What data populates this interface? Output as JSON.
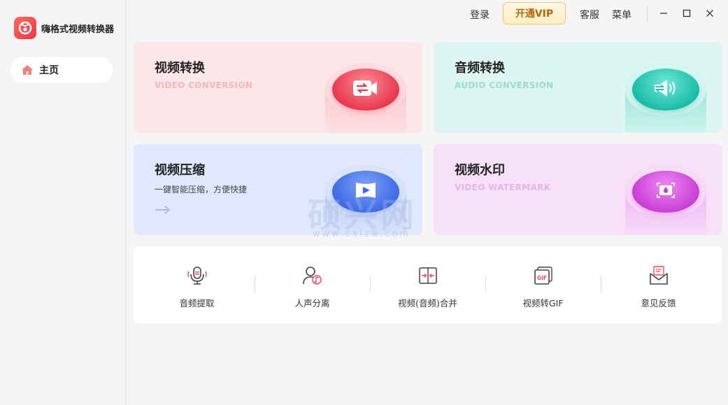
{
  "app": {
    "name": "嗨格式视频转换器"
  },
  "sidebar": {
    "home_label": "主页"
  },
  "topbar": {
    "login": "登录",
    "vip": "开通VIP",
    "service": "客服",
    "menu": "菜单"
  },
  "cards": {
    "video_convert": {
      "title": "视频转换",
      "subtitle": "VIDEO CONVERSION"
    },
    "audio_convert": {
      "title": "音频转换",
      "subtitle": "AUDIO CONVERSION"
    },
    "video_compress": {
      "title": "视频压缩",
      "desc": "一键智能压缩，方便快捷"
    },
    "video_watermark": {
      "title": "视频水印",
      "subtitle": "VIDEO WATERMARK"
    }
  },
  "tools": [
    {
      "label": "音频提取",
      "icon": "microphone-icon"
    },
    {
      "label": "人声分离",
      "icon": "voice-separation-icon"
    },
    {
      "label": "视频(音频)合并",
      "icon": "merge-icon"
    },
    {
      "label": "视频转GIF",
      "icon": "gif-icon"
    },
    {
      "label": "意见反馈",
      "icon": "feedback-mail-icon"
    }
  ],
  "watermark": {
    "text": "硕兴网",
    "url": "www.sxlzw.com"
  },
  "colors": {
    "video_card_bg": "#fde7e8",
    "audio_card_bg": "#def6f1",
    "compress_card_bg": "#dfe8fd",
    "watermark_card_bg": "#f6e1f8",
    "accent_red": "#ee4b5a",
    "vip_text": "#b4670a"
  }
}
